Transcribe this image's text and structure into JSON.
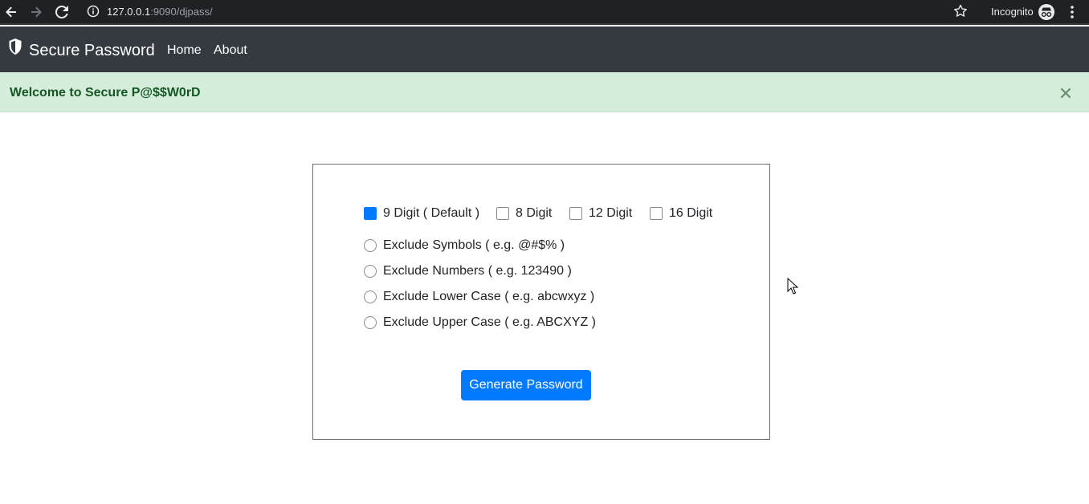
{
  "browser": {
    "url_host": "127.0.0.1",
    "url_rest": ":9090/djpass/",
    "incognito_label": "Incognito"
  },
  "navbar": {
    "brand": "Secure Password",
    "links": [
      "Home",
      "About"
    ]
  },
  "alert": {
    "message": "Welcome to Secure P@$$W0rD",
    "close": "×"
  },
  "length_options": [
    {
      "label": "9 Digit ( Default )",
      "checked": true
    },
    {
      "label": "8 Digit",
      "checked": false
    },
    {
      "label": "12 Digit",
      "checked": false
    },
    {
      "label": "16 Digit",
      "checked": false
    }
  ],
  "exclude_options": [
    {
      "label": "Exclude Symbols ( e.g. @#$% )",
      "selected": false
    },
    {
      "label": "Exclude Numbers ( e.g. 123490 )",
      "selected": false
    },
    {
      "label": "Exclude Lower Case ( e.g. abcwxyz )",
      "selected": false
    },
    {
      "label": "Exclude Upper Case ( e.g. ABCXYZ )",
      "selected": false
    }
  ],
  "generate_button": "Generate Password",
  "colors": {
    "navbar": "#343a40",
    "alert_bg": "#d4edda",
    "alert_text": "#155724",
    "primary": "#007bff"
  }
}
